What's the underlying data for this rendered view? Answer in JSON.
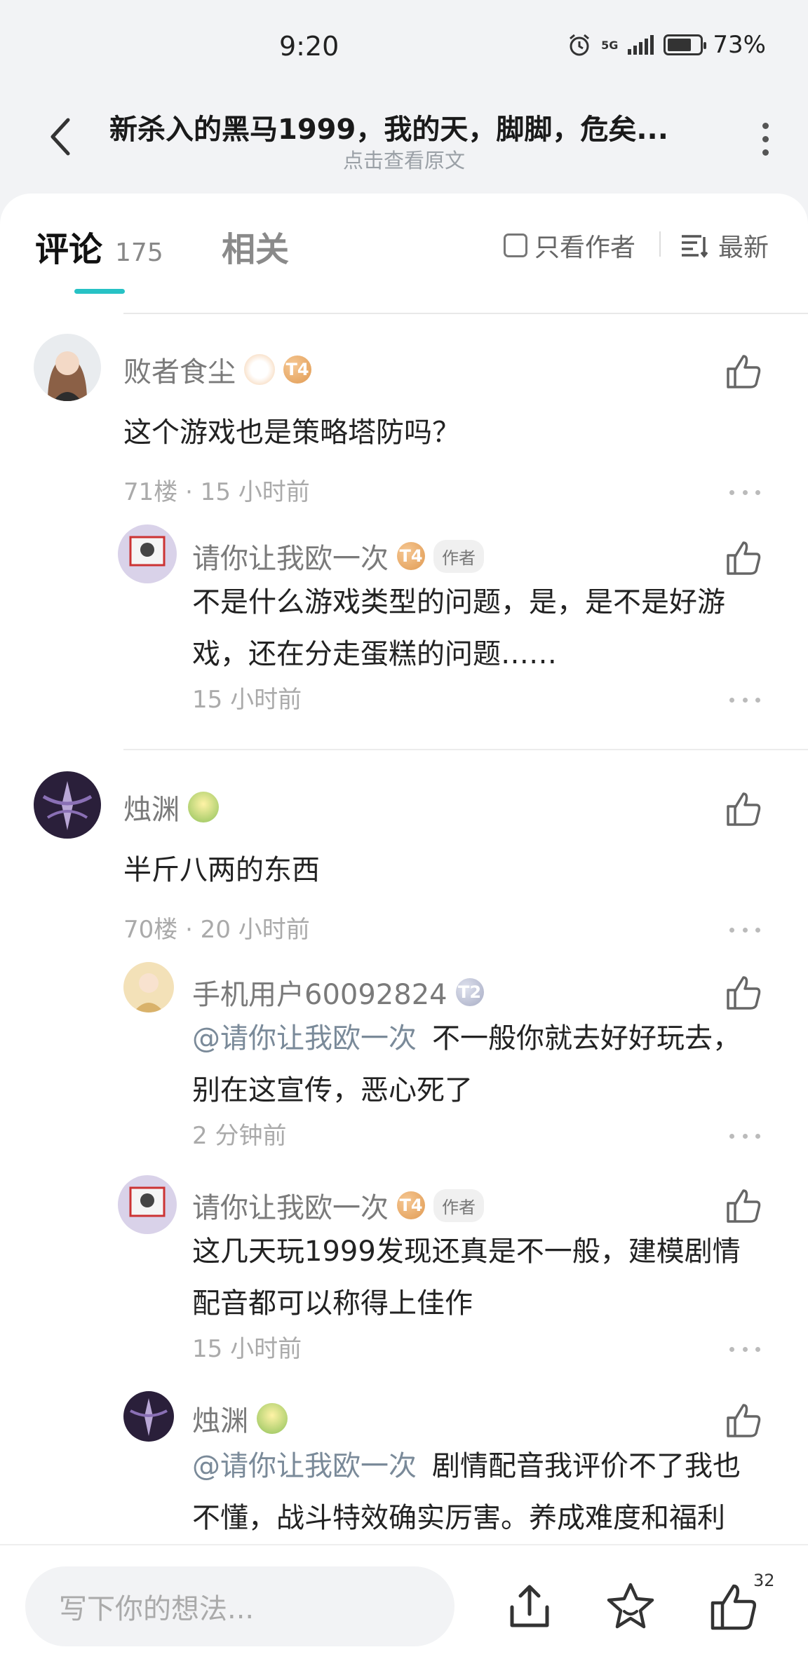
{
  "status_bar": {
    "time": "9:20",
    "battery": "73%",
    "battery_level": 0.73,
    "network": "5G"
  },
  "header": {
    "title": "新杀入的黑马1999，我的天，脚脚，危矣...",
    "subtitle": "点击查看原文"
  },
  "tabs": {
    "comments_label": "评论",
    "comments_count": "175",
    "related_label": "相关",
    "author_only_label": "只看作者",
    "sort_label": "最新"
  },
  "comments": [
    {
      "user": "败者食尘",
      "badge": "T4",
      "text": "这个游戏也是策略塔防吗？",
      "meta": "71楼 · 15 小时前",
      "replies": [
        {
          "user": "请你让我欧一次",
          "badge": "T4",
          "tag": "作者",
          "text": "不是什么游戏类型的问题，是，是不是好游戏，还在分走蛋糕的问题……",
          "meta": "15 小时前"
        }
      ]
    },
    {
      "user": "烛渊",
      "text": "半斤八两的东西",
      "meta": "70楼 · 20 小时前",
      "replies": [
        {
          "user": "手机用户60092824",
          "badge": "T2",
          "mention": "@请你让我欧一次",
          "text": "不一般你就去好好玩去，别在这宣传，恶心死了",
          "meta": "2 分钟前"
        },
        {
          "user": "请你让我欧一次",
          "badge": "T4",
          "tag": "作者",
          "text": "这几天玩1999发现还真是不一般，建模剧情配音都可以称得上佳作",
          "meta": "15 小时前"
        },
        {
          "user": "烛渊",
          "mention": "@请你让我欧一次",
          "text": "剧情配音我评价不了我也不懂，战斗特效确实厉害。养成难度和福利"
        }
      ]
    }
  ],
  "bottom_bar": {
    "input_placeholder": "写下你的想法...",
    "like_count": "32"
  },
  "colors": {
    "accent": "#27c2c5",
    "badge_gold": "#e09a52",
    "badge_silver": "#a7acc4"
  }
}
